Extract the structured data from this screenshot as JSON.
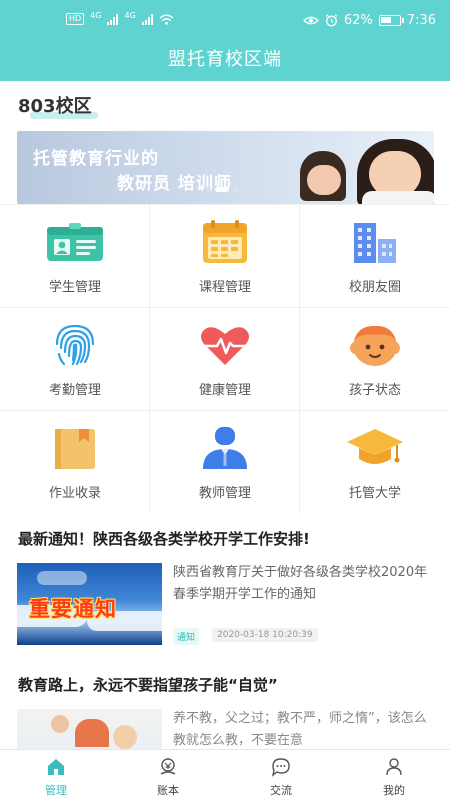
{
  "status_bar": {
    "hd": "HD",
    "network": "4G",
    "battery": "62%",
    "time": "7:36"
  },
  "header": {
    "title": "盟托育校区端"
  },
  "campus": {
    "name": "803校区"
  },
  "banner": {
    "line1": "托管教育行业的",
    "line2": "教研员 培训师",
    "slide_count": 3,
    "active_slide": 2
  },
  "grid": {
    "items": [
      {
        "label": "学生管理",
        "icon": "id-card-icon"
      },
      {
        "label": "课程管理",
        "icon": "calendar-icon"
      },
      {
        "label": "校朋友圈",
        "icon": "buildings-icon"
      },
      {
        "label": "考勤管理",
        "icon": "fingerprint-icon"
      },
      {
        "label": "健康管理",
        "icon": "heart-pulse-icon"
      },
      {
        "label": "孩子状态",
        "icon": "child-face-icon"
      },
      {
        "label": "作业收录",
        "icon": "folder-box-icon"
      },
      {
        "label": "教师管理",
        "icon": "teacher-icon"
      },
      {
        "label": "托管大学",
        "icon": "graduation-cap-icon"
      }
    ]
  },
  "news": [
    {
      "title": "最新通知！陕西各级各类学校开学工作安排!",
      "thumb_text": "重要通知",
      "summary": "陕西省教育厅关于做好各级各类学校2020年春季学期开学工作的通知",
      "tag": "通知",
      "time": "2020-03-18 10:20:39"
    },
    {
      "title": "教育路上，永远不要指望孩子能“自觉”",
      "summary": "养不教，父之过；教不严，师之惰”，该怎么教就怎么教，不要在意"
    }
  ],
  "tabbar": {
    "items": [
      {
        "label": "管理",
        "icon": "home-icon",
        "active": true
      },
      {
        "label": "账本",
        "icon": "ledger-icon",
        "active": false
      },
      {
        "label": "交流",
        "icon": "chat-icon",
        "active": false
      },
      {
        "label": "我的",
        "icon": "user-icon",
        "active": false
      }
    ]
  },
  "colors": {
    "accent": "#5fd3d0",
    "tab_active": "#3cbcc0"
  }
}
